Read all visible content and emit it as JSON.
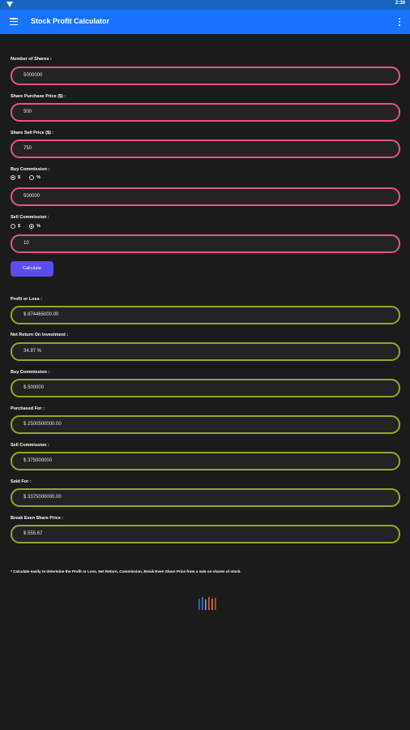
{
  "status_bar": {
    "time": "2:30"
  },
  "app_bar": {
    "title": "Stock Profit Calculator",
    "menu_icon": "hamburger-menu-icon",
    "more_icon": "more-vertical-icon"
  },
  "inputs": {
    "shares": {
      "label": "Number of Shares :",
      "value": "5000000"
    },
    "purchase_price": {
      "label": "Share Purchase Price ($) :",
      "value": "500"
    },
    "sell_price": {
      "label": "Share Sell Price ($) :",
      "value": "750"
    },
    "buy_commission": {
      "label": "Buy Commission :",
      "option_dollar": "$",
      "option_percent": "%",
      "selected": "$",
      "value": "500000"
    },
    "sell_commission": {
      "label": "Sell Commission :",
      "option_dollar": "$",
      "option_percent": "%",
      "selected": "%",
      "value": "10"
    }
  },
  "calculate_button": "Calculate",
  "results": {
    "profit": {
      "label": "Profit or Loss :",
      "value": "$ 874465000.00"
    },
    "roi": {
      "label": "Net Return On Investment :",
      "value": "34.97 %"
    },
    "buy_commission": {
      "label": "Buy Commission :",
      "value": "$ 500000"
    },
    "purchased_for": {
      "label": "Purchased For :",
      "value": "$ 2500500000.00"
    },
    "sell_commission": {
      "label": "Sell Commission :",
      "value": "$ 375000000"
    },
    "sold_for": {
      "label": "Sold For :",
      "value": "$ 3375000000.00"
    },
    "break_even": {
      "label": "Break Even Share Price :",
      "value": "$ 555.67"
    }
  },
  "footnote": "* Calculate easily to determine the Profit or Loss, Net Return, Commission, Break Even Share Price from a sale on shares of stock.",
  "colors": {
    "app_bar": "#1a73ff",
    "input_border": "#e8557a",
    "output_border": "#9aa61e",
    "button": "#5b4cf0",
    "background": "#1b1b1b"
  }
}
